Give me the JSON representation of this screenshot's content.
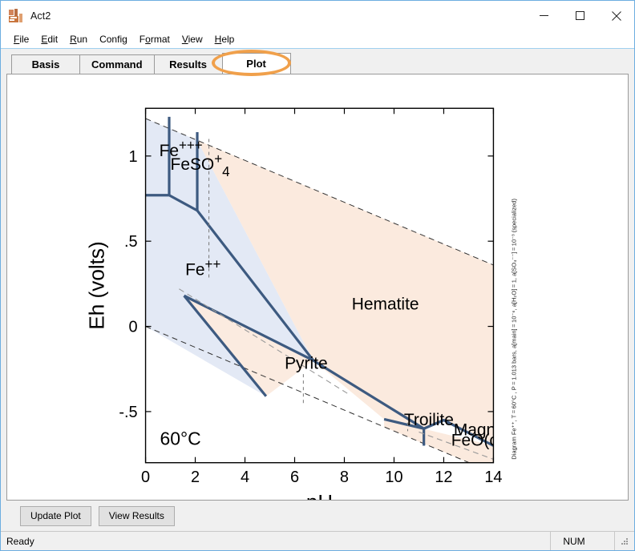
{
  "window": {
    "title": "Act2",
    "icon": "act2-app-icon",
    "minimize_label": "minimize-icon",
    "maximize_label": "maximize-icon",
    "close_label": "close-icon"
  },
  "menu": [
    {
      "label": "File",
      "accel": "F"
    },
    {
      "label": "Edit",
      "accel": "E"
    },
    {
      "label": "Run",
      "accel": "R"
    },
    {
      "label": "Config",
      "accel": "g"
    },
    {
      "label": "Format",
      "accel": "o"
    },
    {
      "label": "View",
      "accel": "V"
    },
    {
      "label": "Help",
      "accel": "H"
    }
  ],
  "tabs": [
    {
      "label": "Basis",
      "active": false
    },
    {
      "label": "Command",
      "active": false
    },
    {
      "label": "Results",
      "active": false
    },
    {
      "label": "Plot",
      "active": true
    }
  ],
  "buttons": {
    "update_plot": "Update Plot",
    "view_results": "View Results"
  },
  "status": {
    "message": "Ready",
    "num": "NUM"
  },
  "chart_data": {
    "type": "line",
    "title": "",
    "xlabel": "pH",
    "ylabel": "Eh (volts)",
    "xlim": [
      0,
      14
    ],
    "ylim": [
      -0.8,
      1.28
    ],
    "xticks": [
      0,
      2,
      4,
      6,
      8,
      10,
      12,
      14
    ],
    "xticklabels": [
      "0",
      "2",
      "4",
      "6",
      "8",
      "10",
      "12",
      "14"
    ],
    "yticks": [
      1,
      0.5,
      0,
      -0.5
    ],
    "yticklabels": [
      "1",
      ".5",
      "0",
      "-.5"
    ],
    "grid": false,
    "legend_position": "none",
    "temperature_annotation": "60°C",
    "caption": "Diagram Fe⁺⁺, T = 60°C , P = 1.013 bars, a[main] = 10⁻⁶, a[H₂O] = 1, a[SO₄⁻⁻] = 10⁻³ (specialized)",
    "caption_rotated": true,
    "fill_colors": {
      "aqueous": "#e3e9f5",
      "mineral": "#fbeade",
      "boundary": "#3d5a80",
      "water_limit": "#555555"
    },
    "field_labels": [
      {
        "text": "Fe",
        "sup": "+++",
        "x": 0.55,
        "y": 1.0,
        "name": "ferric-iron-field"
      },
      {
        "text": "FeSO",
        "sup": "+",
        "sub": "4",
        "x": 1.0,
        "y": 0.92,
        "name": "ferrous-sulfate-field"
      },
      {
        "text": "Fe",
        "sup": "++",
        "x": 1.6,
        "y": 0.3,
        "name": "ferrous-iron-field"
      },
      {
        "text": "Hematite",
        "x": 8.3,
        "y": 0.1,
        "name": "hematite-field"
      },
      {
        "text": "Pyrite",
        "x": 5.6,
        "y": -0.25,
        "name": "pyrite-field"
      },
      {
        "text": "Troilite",
        "x": 10.4,
        "y": -0.58,
        "name": "troilite-field"
      },
      {
        "text": "Magnetite",
        "x": 12.4,
        "y": -0.64,
        "name": "magnetite-field"
      },
      {
        "text": "FeO(c)",
        "x": 12.3,
        "y": -0.7,
        "name": "feo-field"
      }
    ],
    "series": [
      {
        "name": "water-upper-stability",
        "style": "dashed",
        "points": [
          [
            0,
            1.22
          ],
          [
            14,
            0.36
          ]
        ]
      },
      {
        "name": "water-lower-stability",
        "style": "dashed",
        "points": [
          [
            0,
            0.0
          ],
          [
            14,
            -0.86
          ]
        ]
      },
      {
        "name": "fe3-feso4-boundary",
        "style": "solid",
        "points": [
          [
            0.95,
            1.23
          ],
          [
            0.95,
            0.77
          ]
        ]
      },
      {
        "name": "feso4-hematite-boundary",
        "style": "solid",
        "points": [
          [
            2.08,
            1.14
          ],
          [
            2.08,
            0.68
          ]
        ]
      },
      {
        "name": "upper-aqueous-mineral-boundary",
        "style": "solid",
        "points": [
          [
            0.0,
            0.77
          ],
          [
            0.95,
            0.77
          ],
          [
            2.08,
            0.68
          ],
          [
            6.75,
            -0.2
          ]
        ]
      },
      {
        "name": "fe2-pyrite-hematite-boundary",
        "style": "solid",
        "points": [
          [
            6.75,
            -0.2
          ],
          [
            1.55,
            0.18
          ]
        ]
      },
      {
        "name": "pyrite-wedge-lower",
        "style": "solid",
        "points": [
          [
            1.55,
            0.18
          ],
          [
            4.85,
            -0.41
          ]
        ]
      },
      {
        "name": "pyrite-hematite-lower-boundary",
        "style": "solid",
        "points": [
          [
            6.75,
            -0.2
          ],
          [
            11.2,
            -0.6
          ],
          [
            12.0,
            -0.55
          ]
        ]
      },
      {
        "name": "troilite-magnetite-boundary",
        "style": "solid",
        "points": [
          [
            9.6,
            -0.545
          ],
          [
            11.2,
            -0.6
          ],
          [
            12.0,
            -0.55
          ],
          [
            14.0,
            -0.7
          ]
        ]
      },
      {
        "name": "magnetite-feo-divider",
        "style": "solid",
        "points": [
          [
            11.2,
            -0.6
          ],
          [
            11.2,
            -0.7
          ]
        ]
      },
      {
        "name": "hematite-pyrite-inner-dashed",
        "style": "dashed-grey",
        "points": [
          [
            1.35,
            0.22
          ],
          [
            8.2,
            -0.4
          ]
        ]
      },
      {
        "name": "lower-inner-dashed",
        "style": "dashed-grey",
        "points": [
          [
            11.0,
            -0.62
          ],
          [
            14.0,
            -0.78
          ]
        ]
      },
      {
        "name": "sulfate-activity-divider-1",
        "style": "dashed-thin",
        "points": [
          [
            2.55,
            1.1
          ],
          [
            2.55,
            0.28
          ]
        ]
      },
      {
        "name": "sulfate-activity-divider-2",
        "style": "dashed-thin",
        "points": [
          [
            6.35,
            -0.28
          ],
          [
            6.35,
            -0.45
          ]
        ]
      },
      {
        "name": "troilite-tick",
        "style": "dashed-thin",
        "points": [
          [
            10.55,
            -0.565
          ],
          [
            10.55,
            -0.615
          ]
        ]
      }
    ]
  }
}
